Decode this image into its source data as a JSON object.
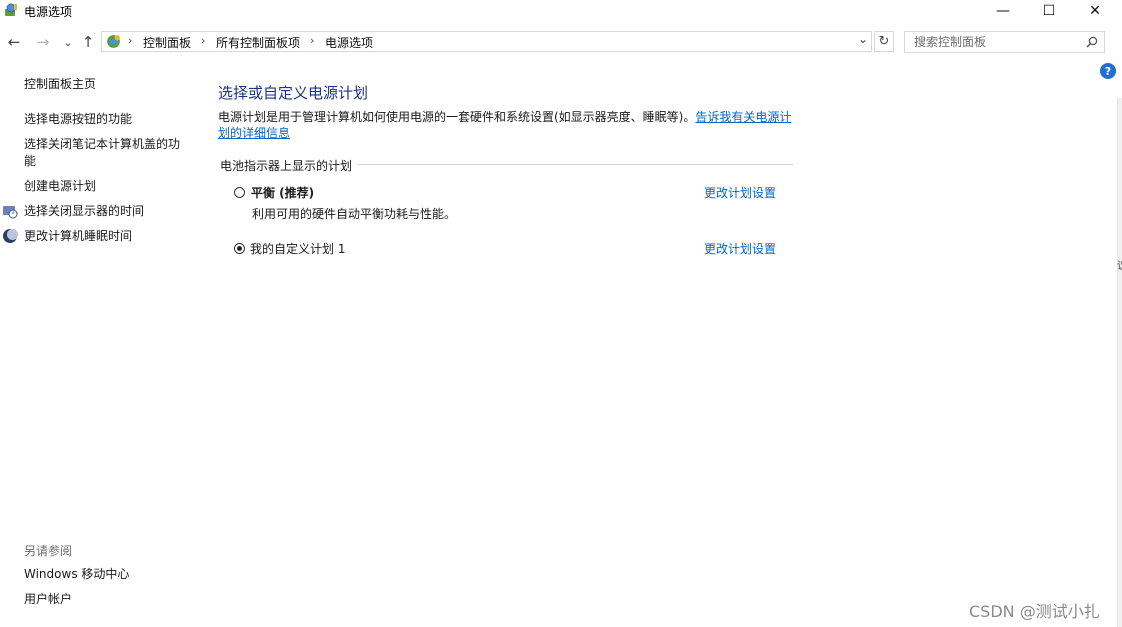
{
  "window": {
    "title": "电源选项",
    "minimize_glyph": "—",
    "maximize_glyph": "☐",
    "close_glyph": "✕"
  },
  "nav": {
    "back_glyph": "←",
    "forward_glyph": "→",
    "recent_glyph": "⌄",
    "up_glyph": "↑",
    "dropdown_glyph": "⌄",
    "refresh_glyph": "↻"
  },
  "breadcrumb": {
    "separator": "›",
    "items": [
      "控制面板",
      "所有控制面板项",
      "电源选项"
    ]
  },
  "search": {
    "placeholder": "搜索控制面板",
    "value": ""
  },
  "sidebar": {
    "home_link": "控制面板主页",
    "items": [
      "选择电源按钮的功能",
      "选择关闭笔记本计算机盖的功能",
      "创建电源计划",
      "选择关闭显示器的时间",
      "更改计算机睡眠时间"
    ],
    "see_also": {
      "heading": "另请参阅",
      "links": [
        "Windows 移动中心",
        "用户帐户"
      ]
    }
  },
  "main": {
    "title": "选择或自定义电源计划",
    "description": "电源计划是用于管理计算机如何使用电源的一套硬件和系统设置(如显示器亮度、睡眠等)。",
    "learn_more": "告诉我有关电源计划的详细信息",
    "group_heading": "电池指示器上显示的计划",
    "plans": [
      {
        "name": "平衡 (推荐)",
        "description": "利用可用的硬件自动平衡功耗与性能。",
        "link": "更改计划设置",
        "selected": false
      },
      {
        "name": "我的自定义计划 1",
        "link": "更改计划设置",
        "selected": true
      }
    ]
  },
  "help": {
    "glyph": "?"
  },
  "edge_fragment": "议",
  "watermark": "CSDN @测试小扎",
  "colors": {
    "title_blue": "#1e3287",
    "link_blue": "#0066cc",
    "help_blue": "#1e6fd1"
  },
  "icons": {
    "app": "power-options-icon",
    "address": "control-panel-icon",
    "search": "search-icon",
    "display_timer": "display-clock-icon",
    "sleep": "moon-icon"
  }
}
